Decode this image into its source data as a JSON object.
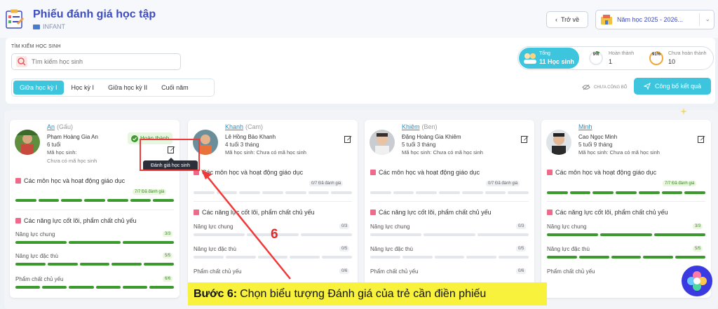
{
  "header": {
    "title": "Phiếu đánh giá học tập",
    "subtitle": "INFANT",
    "back_label": "Trở về",
    "year_label": "Năm học 2025 - 2026..."
  },
  "search": {
    "label": "TÌM KIẾM HỌC SINH",
    "placeholder": "Tìm kiếm học sinh"
  },
  "tabs": [
    {
      "label": "Giữa học kỳ I",
      "active": true
    },
    {
      "label": "Học kỳ I",
      "active": false
    },
    {
      "label": "Giữa học kỳ II",
      "active": false
    },
    {
      "label": "Cuối năm",
      "active": false
    }
  ],
  "stats": {
    "total_label": "Tổng",
    "total_value": "11 Học sinh",
    "done_label": "Hoàn thành",
    "done_value": "1",
    "done_pct": "9%",
    "pending_label": "Chưa hoàn thành",
    "pending_value": "10",
    "pending_pct": "91%"
  },
  "actions": {
    "unpublished_label": "CHƯA CÔNG BỐ",
    "publish_label": "Công bố kết quả"
  },
  "sections": {
    "subjects": "Các môn học và hoạt động giáo dục",
    "competencies": "Các năng lực cốt lõi, phẩm chất chủ yếu",
    "rows": [
      "Năng lực chung",
      "Năng lực đặc thù",
      "Phẩm chất chủ yếu"
    ]
  },
  "students": [
    {
      "nick": "An",
      "alias": "(Gấu)",
      "fullname": "Phạm Hoàng Gia An",
      "age": "6 tuổi",
      "id_label": "Mã học sinh:",
      "id_value": "Chưa có mã học sinh",
      "status": "Hoàn thành",
      "subjects_badge": "7/7 Đã đánh giá",
      "row_badges": [
        "3/3",
        "5/5",
        "6/6"
      ]
    },
    {
      "nick": "Khanh",
      "alias": "(Cam)",
      "fullname": "Lê Hồng Bảo Khanh",
      "age": "4 tuổi 3 tháng",
      "id_label": "Mã học sinh:",
      "id_value": "Chưa có mã học sinh",
      "subjects_badge": "0/7 Đã đánh giá",
      "row_badges": [
        "0/3",
        "0/5",
        "0/6"
      ]
    },
    {
      "nick": "Khiêm",
      "alias": "(Ben)",
      "fullname": "Đặng Hoàng Gia Khiêm",
      "age": "5 tuổi 3 tháng",
      "id_label": "Mã học sinh:",
      "id_value": "Chưa có mã học sinh",
      "subjects_badge": "0/7 Đã đánh giá",
      "row_badges": [
        "0/3",
        "0/5",
        "0/6"
      ]
    },
    {
      "nick": "Minh",
      "alias": "",
      "fullname": "Cao Ngọc Minh",
      "age": "5 tuổi 9 tháng",
      "id_label": "Mã học sinh:",
      "id_value": "Chưa có mã học sinh",
      "subjects_badge": "7/7 Đã đánh giá",
      "row_badges": [
        "3/3",
        "5/5",
        ""
      ]
    }
  ],
  "tooltip": "Đánh giá học sinh",
  "annotation": {
    "step_number": "6",
    "step_prefix": "Bước 6:",
    "step_text": "Chọn biểu tượng Đánh giá của trẻ cần điền phiếu"
  },
  "colors": {
    "accent": "#3ec5de",
    "brand": "#3d4cc2",
    "progress_done": "#3a9a2c",
    "highlight": "#ef3a3a",
    "instruction_bg": "#f8f23c"
  }
}
